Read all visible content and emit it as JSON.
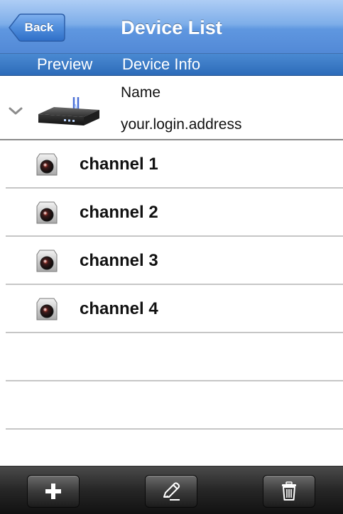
{
  "navbar": {
    "back_label": "Back",
    "title": "Device List",
    "colors": {
      "bar": "#6a9fe2",
      "back_button": "#3a78d0"
    }
  },
  "segments": [
    {
      "label": "Preview"
    },
    {
      "label": "Device Info"
    }
  ],
  "device": {
    "icon": "dvr-device-icon",
    "expand_icon": "chevron-down-icon",
    "name": "Name",
    "address": "your.login.address"
  },
  "channels": [
    {
      "label": "channel 1",
      "icon": "camera-icon"
    },
    {
      "label": "channel 2",
      "icon": "camera-icon"
    },
    {
      "label": "channel 3",
      "icon": "camera-icon"
    },
    {
      "label": "channel 4",
      "icon": "camera-icon"
    }
  ],
  "toolbar": {
    "buttons": [
      {
        "icon": "plus-icon",
        "action": "add"
      },
      {
        "icon": "pencil-icon",
        "action": "edit"
      },
      {
        "icon": "trash-icon",
        "action": "delete"
      }
    ]
  }
}
